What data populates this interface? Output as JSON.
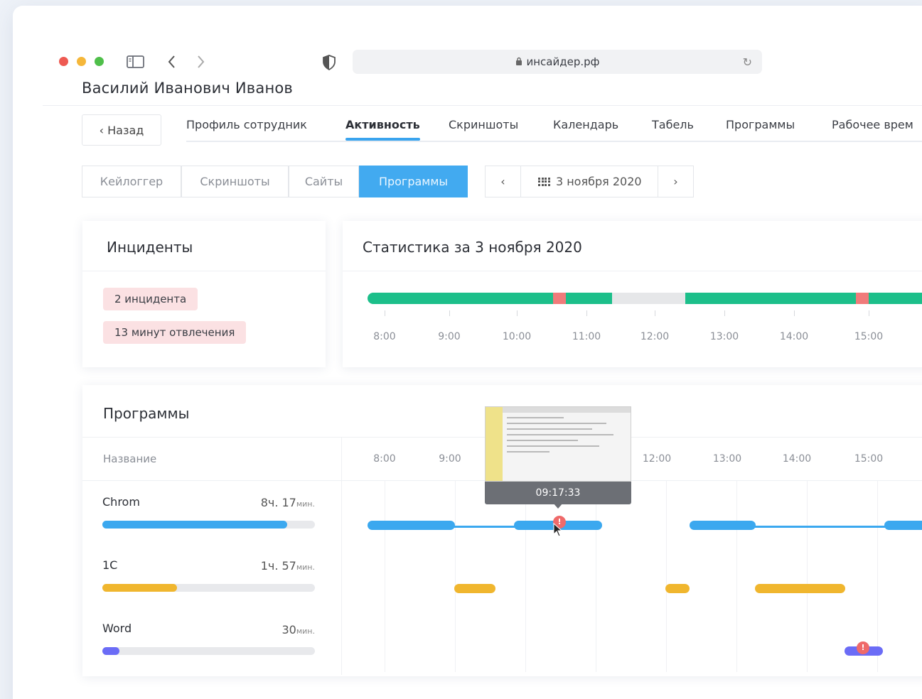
{
  "browser": {
    "url": "инсайдер.рф",
    "lock_icon": "lock-icon",
    "reload_icon": "reload-icon"
  },
  "user": {
    "name": "Василий Иванович Иванов"
  },
  "nav": {
    "back_label": "‹ Назад",
    "tabs": [
      {
        "label": "Профиль сотрудник",
        "active": false
      },
      {
        "label": "Активность",
        "active": true
      },
      {
        "label": "Скриншоты",
        "active": false
      },
      {
        "label": "Календарь",
        "active": false
      },
      {
        "label": "Табель",
        "active": false
      },
      {
        "label": "Программы",
        "active": false
      },
      {
        "label": "Рабочее врем",
        "active": false
      }
    ]
  },
  "subtabs": [
    {
      "label": "Кейлоггер",
      "active": false
    },
    {
      "label": "Скриншоты",
      "active": false
    },
    {
      "label": "Сайты",
      "active": false
    },
    {
      "label": "Программы",
      "active": true
    }
  ],
  "date_nav": {
    "prev": "‹",
    "date": "3 ноября 2020",
    "next": "›"
  },
  "incidents": {
    "title": "Инциденты",
    "badges": [
      "2 инцидента",
      "13 минут отвлечения"
    ]
  },
  "stats": {
    "title": "Статистика за 3 ноября 2020",
    "hours": [
      "8:00",
      "9:00",
      "10:00",
      "11:00",
      "12:00",
      "13:00",
      "14:00",
      "15:00"
    ],
    "colors": {
      "active": "#1cbf8a",
      "idle": "#e6e7e9",
      "incident": "#f07b7b"
    }
  },
  "programs": {
    "title": "Программы",
    "column_name": "Название",
    "hours": [
      "8:00",
      "9:00",
      "12:00",
      "13:00",
      "14:00",
      "15:00"
    ],
    "items": [
      {
        "name": "Chrom",
        "hours": "8ч.",
        "minutes": "17",
        "unit": "мин.",
        "color": "#3ba8ef",
        "fraction": 0.87
      },
      {
        "name": "1С",
        "hours": "1ч.",
        "minutes": "57",
        "unit": "мин.",
        "color": "#f0b62e",
        "fraction": 0.35
      },
      {
        "name": "Word",
        "hours": "",
        "minutes": "30",
        "unit": "мин.",
        "color": "#6b6cf6",
        "fraction": 0.08
      }
    ],
    "tooltip_time": "09:17:33",
    "marker_label": "!"
  }
}
